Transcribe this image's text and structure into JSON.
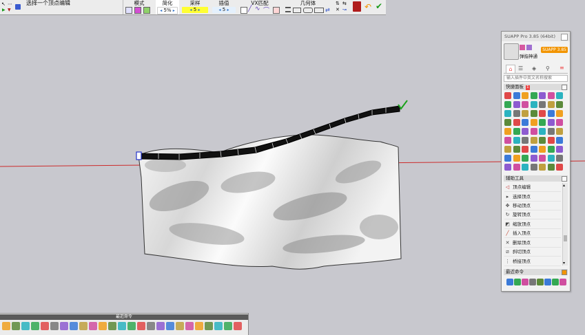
{
  "app_title": "SUAPP Pro 3.85 (64bit)",
  "toolbar": {
    "status_text": "选择一个顶点编辑",
    "groups": [
      {
        "title": "模式"
      },
      {
        "title": "简化",
        "value": "5%"
      },
      {
        "title": "采样",
        "value": "5"
      },
      {
        "title": "插值",
        "value": "5"
      },
      {
        "title": "VX匹配"
      },
      {
        "title": "几何体"
      }
    ]
  },
  "panel": {
    "user_name": "弹指神通",
    "version_badge": "SUAPP 3.85",
    "search_placeholder": "输入插件中英文名称搜索",
    "quick_panel_label": "快捷面板",
    "quick_panel_num": "1",
    "aux_tools_label": "辅助工具",
    "commands": [
      {
        "label": "顶点编辑",
        "icon": "vertex-edit-icon"
      },
      {
        "label": "选择顶点",
        "icon": "select-vertex-icon"
      },
      {
        "label": "移动顶点",
        "icon": "move-vertex-icon"
      },
      {
        "label": "旋转顶点",
        "icon": "rotate-vertex-icon"
      },
      {
        "label": "缩放顶点",
        "icon": "scale-vertex-icon"
      },
      {
        "label": "插入顶点",
        "icon": "insert-vertex-icon"
      },
      {
        "label": "删除顶点",
        "icon": "delete-vertex-icon"
      },
      {
        "label": "斜切顶点",
        "icon": "shear-vertex-icon"
      },
      {
        "label": "桥接顶点",
        "icon": "bridge-vertex-icon"
      }
    ],
    "recent_label": "最近命令"
  },
  "bottombar": {
    "title": "最近命令"
  },
  "colors": {
    "viewport": "#c8c8ce",
    "axis_red": "#cc2a2a",
    "accent_orange": "#f29400",
    "highlight_yellow": "#ffff33"
  }
}
